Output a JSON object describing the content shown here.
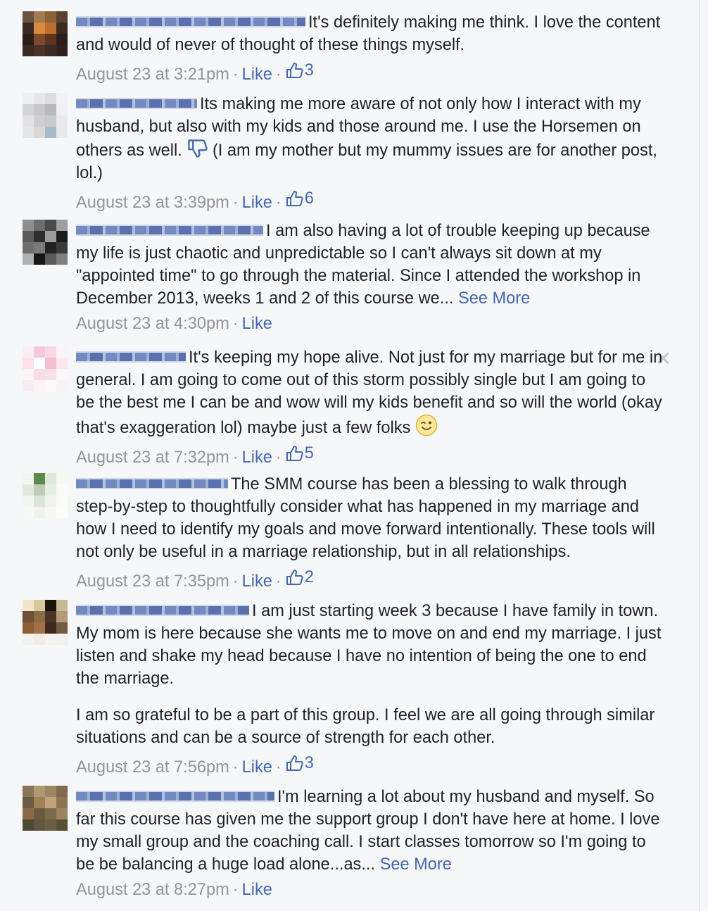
{
  "colors": {
    "link": "#4267b2",
    "meta": "#90949c",
    "text": "#1d2129",
    "background": "#f6f7f9"
  },
  "comments": [
    {
      "text": "It's definitely making me think. I love the content and would of never of thought of these things myself.",
      "time": "August 23 at 3:21pm",
      "like_label": "Like",
      "reaction_count": "3",
      "avatar_icon": "user-avatar-icon"
    },
    {
      "text_before_icon": "Its making me more aware of not only how I interact with my husband, but also with my kids and those around me. I use the Horsemen on others as well.",
      "inline_icon": "thumbs-down-icon",
      "text_after_icon": "(I am my mother but my mummy issues are for another post, lol.)",
      "time": "August 23 at 3:39pm",
      "like_label": "Like",
      "reaction_count": "6",
      "avatar_icon": "user-avatar-icon"
    },
    {
      "text": "I am also having a lot of trouble keeping up because my life is just chaotic and unpredictable so I can't always sit down at my \"appointed time\" to go through the material. Since I attended the workshop in December 2013, weeks 1 and 2 of this course we...",
      "see_more": "See More",
      "time": "August 23 at 4:30pm",
      "like_label": "Like",
      "avatar_icon": "user-avatar-icon"
    },
    {
      "text": "It's keeping my hope alive. Not just for my marriage but for me in general. I am going to come out of this storm possibly single but I am going to be the best me I can be and wow will my kids benefit and so will the world (okay that's exaggeration lol) maybe just a few folks",
      "inline_icon": "wink-emoji-icon",
      "close_icon": "close-icon",
      "close_glyph": "✕",
      "time": "August 23 at 7:32pm",
      "like_label": "Like",
      "reaction_count": "5",
      "avatar_icon": "user-avatar-icon"
    },
    {
      "text": "The SMM course has been a blessing to walk through step-by-step to thoughtfully consider what has happened in my marriage and how I need to identify my goals and move forward intentionally. These tools will not only be useful in a marriage relationship, but in all relationships.",
      "time": "August 23 at 7:35pm",
      "like_label": "Like",
      "reaction_count": "2",
      "avatar_icon": "user-avatar-icon"
    },
    {
      "text": "I am just starting week 3 because I have family in town. My mom is here because she wants me to move on and end my marriage. I just listen and shake my head because I have no intention of being the one to end the marriage.",
      "text2": "I am so grateful to be a part of this group. I feel we are all going through similar situations and can be a source of strength for each other.",
      "time": "August 23 at 7:56pm",
      "like_label": "Like",
      "reaction_count": "3",
      "avatar_icon": "user-avatar-icon"
    },
    {
      "text": "I'm learning a lot about my husband and myself. So far this course has given me the support group I don't have here at home. I love my small group and the coaching call. I start classes tomorrow so I'm going to be be balancing a huge load alone...as...",
      "see_more": "See More",
      "time": "August 23 at 8:27pm",
      "like_label": "Like",
      "avatar_icon": "user-avatar-icon"
    }
  ],
  "separator": "·"
}
